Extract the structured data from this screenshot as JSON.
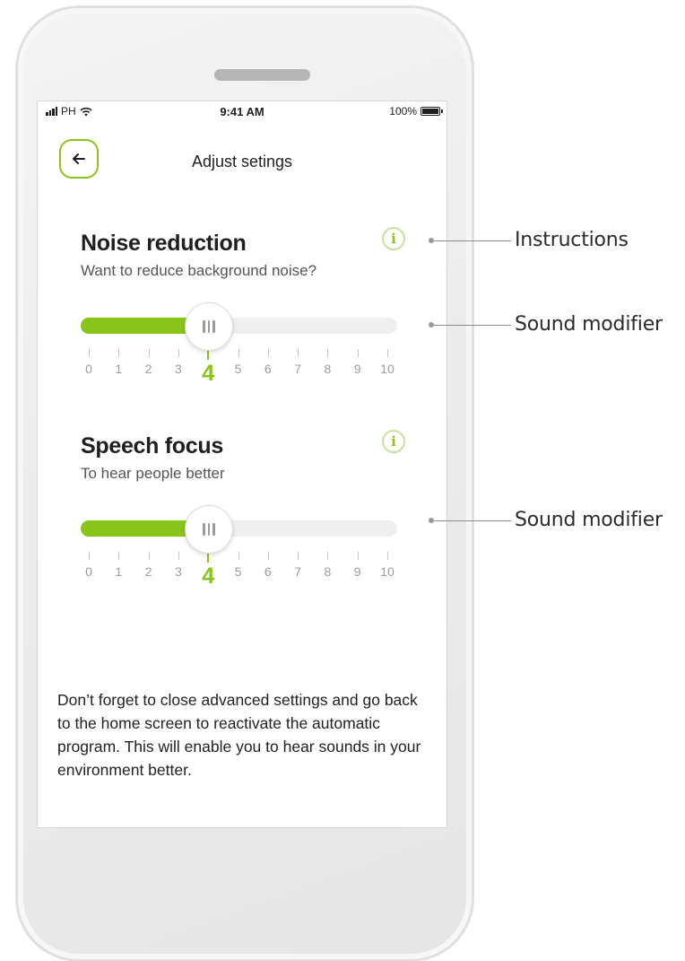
{
  "status_bar": {
    "carrier": "PH",
    "time": "9:41 AM",
    "battery": "100%",
    "signal_icon": "signal-bars-icon",
    "wifi_icon": "wifi-icon",
    "battery_icon": "battery-icon"
  },
  "header": {
    "title": "Adjust setings",
    "back_icon": "arrow-left-icon"
  },
  "settings": [
    {
      "title": "Noise reduction",
      "subtitle": "Want to reduce background noise?",
      "info_label": "i",
      "slider": {
        "min": 0,
        "max": 10,
        "value": 4,
        "selected_label": "4",
        "scale_labels": [
          "0",
          "1",
          "2",
          "3",
          "",
          "5",
          "6",
          "7",
          "8",
          "9",
          "10"
        ]
      }
    },
    {
      "title": "Speech focus",
      "subtitle": "To hear people better",
      "info_label": "i",
      "slider": {
        "min": 0,
        "max": 10,
        "value": 4,
        "selected_label": "4",
        "scale_labels": [
          "0",
          "1",
          "2",
          "3",
          "",
          "5",
          "6",
          "7",
          "8",
          "9",
          "10"
        ]
      }
    }
  ],
  "footer_note": "Don’t forget to close advanced settings and go back to the home screen to reactivate the automatic program. This will enable you to hear sounds in your environment better.",
  "callouts": {
    "instructions": "Instructions",
    "sound_modifier_1": "Sound modifier",
    "sound_modifier_2": "Sound modifier"
  },
  "colors": {
    "accent": "#88c41a",
    "track": "#efefef",
    "text": "#1f1f1f"
  }
}
